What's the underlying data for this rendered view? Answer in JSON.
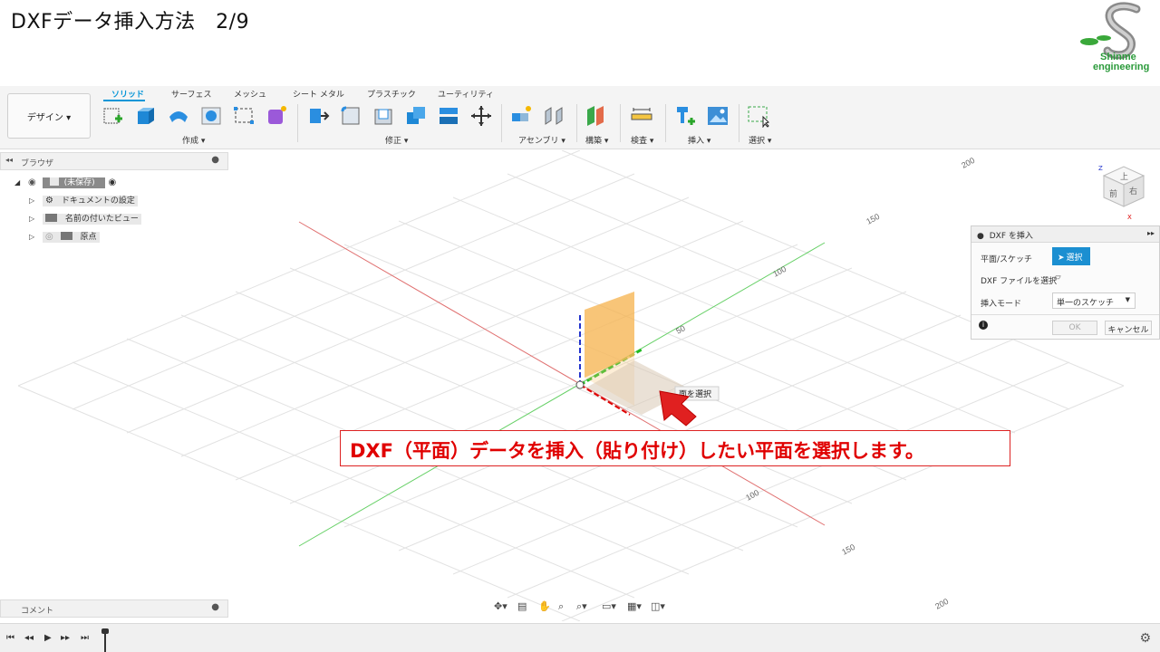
{
  "slide": {
    "title": "DXFデータ挿入方法　2/9",
    "logo_line1": "Shinme",
    "logo_line2": "engineering"
  },
  "toolbar": {
    "workspace": "デザイン ▾",
    "tabs": [
      "ソリッド",
      "サーフェス",
      "メッシュ",
      "シート メタル",
      "プラスチック",
      "ユーティリティ"
    ],
    "groups": {
      "create": "作成 ▾",
      "modify": "修正 ▾",
      "assemble": "アセンブリ ▾",
      "construct": "構築 ▾",
      "inspect": "検査 ▾",
      "insert": "挿入 ▾",
      "select": "選択 ▾"
    }
  },
  "browser": {
    "title": "ブラウザ",
    "root": "(未保存)",
    "items": [
      "ドキュメントの設定",
      "名前の付いたビュー",
      "原点"
    ],
    "comment": "コメント"
  },
  "viewport": {
    "axis_labels": [
      "200",
      "150",
      "100",
      "50",
      "100",
      "150",
      "200"
    ],
    "tooltip": "面を選択",
    "viewcube": {
      "top": "上",
      "front": "前",
      "right": "右",
      "z": "Z",
      "x": "X"
    }
  },
  "dialog": {
    "title": "DXF を挿入",
    "plane_label": "平面/スケッチ",
    "select_button": "選択",
    "file_label": "DXF ファイルを選択",
    "mode_label": "挿入モード",
    "mode_value": "単一のスケッチ",
    "ok": "OK",
    "cancel": "キャンセル"
  },
  "annotation": {
    "text": "DXF（平面）データを挿入（貼り付け）したい平面を選択します。"
  }
}
